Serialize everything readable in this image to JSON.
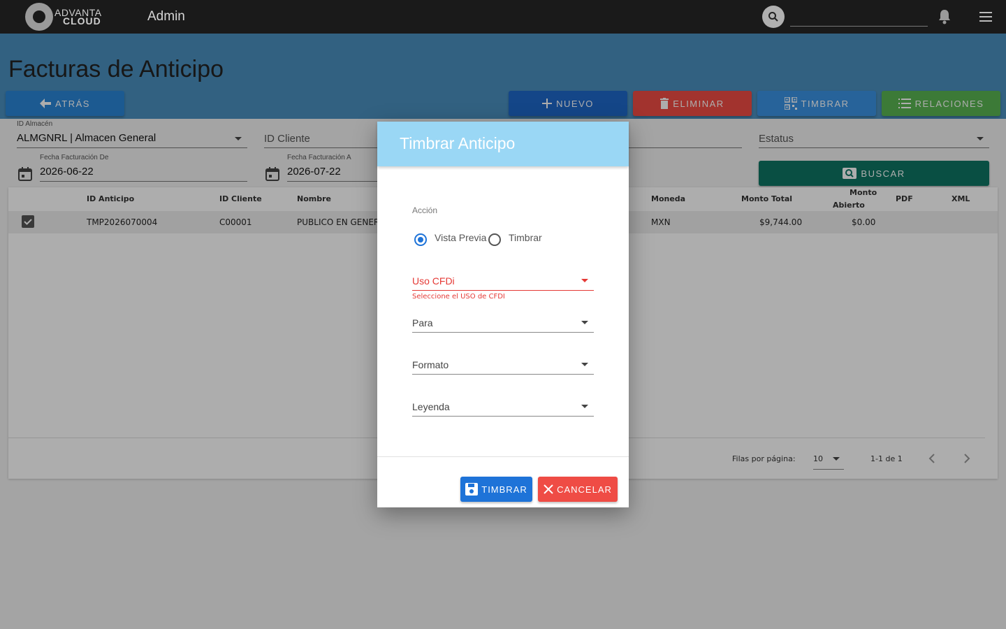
{
  "topbar": {
    "brand_line1": "ADVANTA",
    "brand_line2": "CLOUD",
    "app_title": "Admin",
    "search_value": ""
  },
  "page": {
    "title": "Facturas de Anticipo",
    "buttons": {
      "back": "ATRÁS",
      "new": "NUEVO",
      "delete": "ELIMINAR",
      "stamp": "TIMBRAR",
      "relations": "RELACIONES",
      "search": "BUSCAR"
    }
  },
  "filters": {
    "warehouse_label": "ID Almacén",
    "warehouse_value": "ALMGNRL | Almacen General",
    "client_placeholder": "ID Cliente",
    "status_placeholder": "Estatus",
    "date_from_label": "Fecha Facturación De",
    "date_from_value": "2026-06-22",
    "date_to_label": "Fecha Facturación A",
    "date_to_value": "2026-07-22"
  },
  "table": {
    "headers": {
      "id_anticipo": "ID Anticipo",
      "id_cliente": "ID Cliente",
      "nombre": "Nombre",
      "moneda": "Moneda",
      "monto_total": "Monto Total",
      "monto_abierto_1": "Monto",
      "monto_abierto_2": "Abierto",
      "pdf": "PDF",
      "xml": "XML"
    },
    "rows": [
      {
        "id_anticipo": "TMP2026070004",
        "id_cliente": "C00001",
        "nombre": "PUBLICO EN GENER",
        "moneda": "MXN",
        "monto_total": "$9,744.00",
        "monto_abierto": "$0.00"
      }
    ],
    "footer": {
      "rows_per_page_label": "Filas por página:",
      "rows_per_page_value": "10",
      "range": "1-1 de 1"
    }
  },
  "dialog": {
    "title": "Timbrar Anticipo",
    "accion_label": "Acción",
    "radio_preview": "Vista Previa",
    "radio_stamp": "Timbrar",
    "selected": "Vista Previa",
    "uso_cfdi_label": "Uso CFDi",
    "uso_cfdi_error": "Seleccione el USO de CFDI",
    "para_label": "Para",
    "formato_label": "Formato",
    "leyenda_label": "Leyenda",
    "btn_stamp": "TIMBRAR",
    "btn_cancel": "CANCELAR"
  },
  "colors": {
    "topbar": "#1a1a1a",
    "header_band": "#4a8fbf",
    "btn_back": "#2a85d6",
    "btn_new": "#1e68c9",
    "btn_delete": "#ef4c45",
    "btn_stamp": "#3a93e3",
    "btn_relations": "#59b451",
    "btn_search": "#0e7564",
    "dialog_header": "#9ad7f5",
    "error": "#e53935",
    "dialog_btn_stamp": "#1e73d8",
    "dialog_btn_cancel": "#ef4c45"
  }
}
